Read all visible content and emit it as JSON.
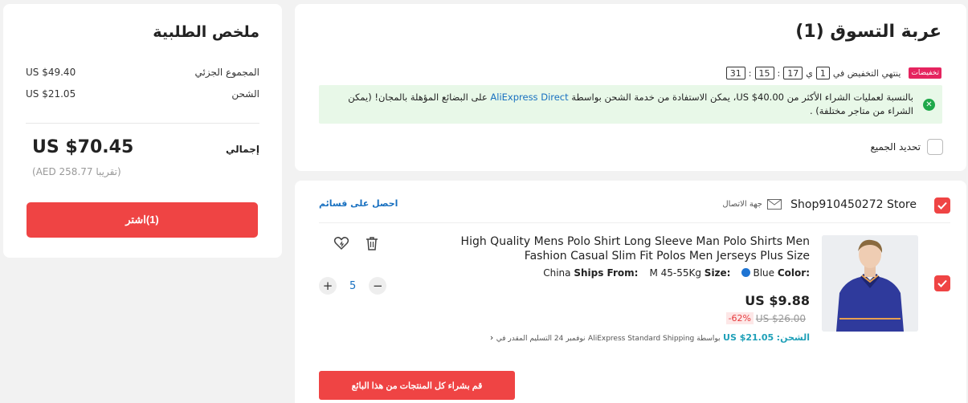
{
  "summary": {
    "title": "ملخص الطلبية",
    "subtotal_label": "المجموع الجزئي",
    "subtotal_value": "US $49.40",
    "shipping_label": "الشحن",
    "shipping_value": "US $21.05",
    "total_label": "إجمالي",
    "total_value": "US $70.45",
    "approx_value": "(تقريبا AED 258.77)",
    "buy_button": "(1)اشتر"
  },
  "cart": {
    "title": "عربة التسوق (1)",
    "badge": "تخفيضات",
    "timer_label": "ينتهي التخفيض في",
    "days": "1",
    "days_suffix": "ي",
    "hours": "17",
    "minutes": "15",
    "seconds": "31",
    "info_text_a": "بالنسبة لعمليات الشراء الأكثر من US $40.00، يمكن الاستفادة من خدمة الشحن بواسطة",
    "info_link": "AliExpress Direct",
    "info_text_b": "على البضائع المؤهلة بالمجان! (يمكن الشراء من متاجر مختلفة) .",
    "select_all": "تحديد الجميع"
  },
  "store": {
    "name": "Shop910450272 Store",
    "contact": "جهة الاتصال",
    "coupons": "احصل على قسائم"
  },
  "item": {
    "title": "High Quality Mens Polo Shirt Long Sleeve Man Polo Shirts Men Fashion Casual Slim Fit Polos Men Jerseys Plus Size",
    "color_label": "Color:",
    "color_value": "Blue",
    "size_label": "Size:",
    "size_value": "M 45-55Kg",
    "ships_label": "Ships From:",
    "ships_value": "China",
    "price": "US $9.88",
    "old_price": "US $26.00",
    "discount": "-62%",
    "quantity": "5",
    "shipping_label": "الشحن:",
    "shipping_price": "US $21.05",
    "shipping_via": "بواسطة AliExpress Standard Shipping",
    "delivery": "نوفمبر 24 التسليم المقدر في",
    "seller_button": "قم بشراء كل المنتجات من هذا البائع"
  },
  "colors": {
    "accent": "#ef4444",
    "badge": "#e5245f",
    "link": "#1870c0",
    "info_bg": "#e8f8e8",
    "success": "#1fa84a"
  }
}
